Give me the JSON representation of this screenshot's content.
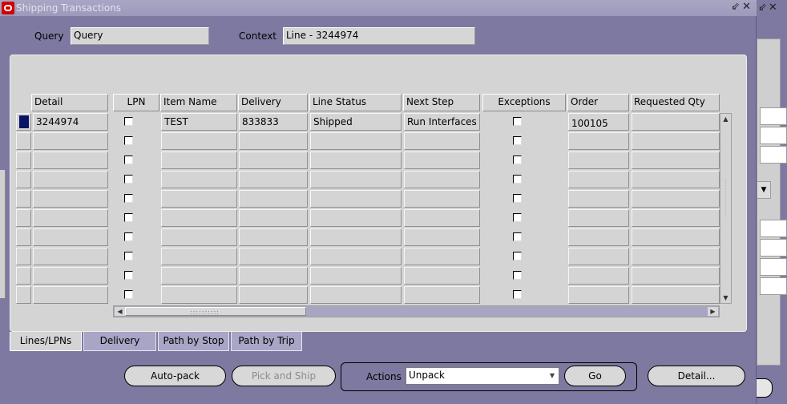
{
  "window": {
    "title": "Shipping Transactions",
    "controls": "⇙✕"
  },
  "header": {
    "query_label": "Query",
    "query_value": "Query",
    "context_label": "Context",
    "context_value": "Line - 3244974"
  },
  "table": {
    "columns": [
      "Detail",
      "LPN",
      "Item Name",
      "Delivery",
      "Line Status",
      "Next Step",
      "Exceptions",
      "Order",
      "Requested Qty"
    ],
    "rows": [
      {
        "detail": "3244974",
        "item_name": "TEST",
        "delivery": "833833",
        "line_status": "Shipped",
        "next_step": "Run Interfaces",
        "order": "100105"
      }
    ]
  },
  "tabs": [
    "Lines/LPNs",
    "Delivery",
    "Path by Stop",
    "Path by Trip"
  ],
  "buttons": {
    "autopack": "Auto-pack",
    "pick_and_ship": "Pick and Ship",
    "actions_label": "Actions",
    "actions_value": "Unpack",
    "go": "Go",
    "detail": "Detail..."
  },
  "colors": {
    "background": "#7d79a0",
    "panel": "#d4d4d4",
    "selected_row_indicator": "#0a1464"
  }
}
